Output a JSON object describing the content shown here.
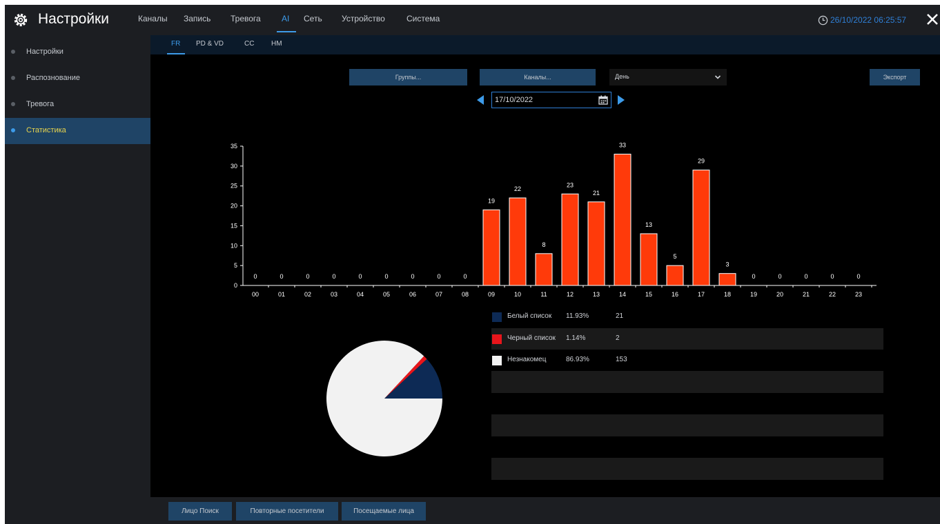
{
  "app": {
    "title": "Настройки"
  },
  "menu": {
    "items": [
      "Каналы",
      "Запись",
      "Тревога",
      "AI",
      "Сеть",
      "Устройство",
      "Система"
    ],
    "active": "AI"
  },
  "clock": "26/10/2022 06:25:57",
  "sidebar": {
    "items": [
      "Настройки",
      "Распознование",
      "Тревога",
      "Статистика"
    ],
    "active": "Статистика"
  },
  "subtabs": {
    "items": [
      "FR",
      "PD & VD",
      "CC",
      "HM"
    ],
    "active": "FR"
  },
  "toolbar": {
    "groups_label": "Группы...",
    "channels_label": "Каналы...",
    "period_value": "День",
    "export_label": "Экспорт",
    "date_value": "17/10/2022"
  },
  "colors": {
    "accent": "#3d9be9",
    "bar": "#ff3a0a",
    "whitelist": "#0d2a55",
    "blacklist": "#e8151b",
    "stranger": "#f2f2f2"
  },
  "icons": {
    "gear": "gear-icon",
    "clock": "clock-icon",
    "close": "close-icon",
    "calendar": "calendar-icon",
    "prev": "arrow-left-icon",
    "next": "arrow-right-icon",
    "chevron": "chevron-down-icon"
  },
  "chart_data": [
    {
      "type": "bar",
      "categories": [
        "00",
        "01",
        "02",
        "03",
        "04",
        "05",
        "06",
        "07",
        "08",
        "09",
        "10",
        "11",
        "12",
        "13",
        "14",
        "15",
        "16",
        "17",
        "18",
        "19",
        "20",
        "21",
        "22",
        "23"
      ],
      "values": [
        0,
        0,
        0,
        0,
        0,
        0,
        0,
        0,
        0,
        19,
        22,
        8,
        23,
        21,
        33,
        13,
        5,
        29,
        3,
        0,
        0,
        0,
        0,
        0
      ],
      "ylim": [
        0,
        35
      ],
      "yticks": [
        0,
        5,
        10,
        15,
        20,
        25,
        30,
        35
      ]
    },
    {
      "type": "pie",
      "labels": [
        "Белый список",
        "Черный список",
        "Незнакомец"
      ],
      "values": [
        21,
        2,
        153
      ]
    }
  ],
  "legend": [
    {
      "name": "Белый список",
      "pct": "11.93%",
      "count": "21"
    },
    {
      "name": "Черный список",
      "pct": "1.14%",
      "count": "2"
    },
    {
      "name": "Незнакомец",
      "pct": "86.93%",
      "count": "153"
    }
  ],
  "bottom": {
    "buttons": [
      "Лицо Поиск",
      "Повторные посетители",
      "Посещаемые лица"
    ]
  }
}
